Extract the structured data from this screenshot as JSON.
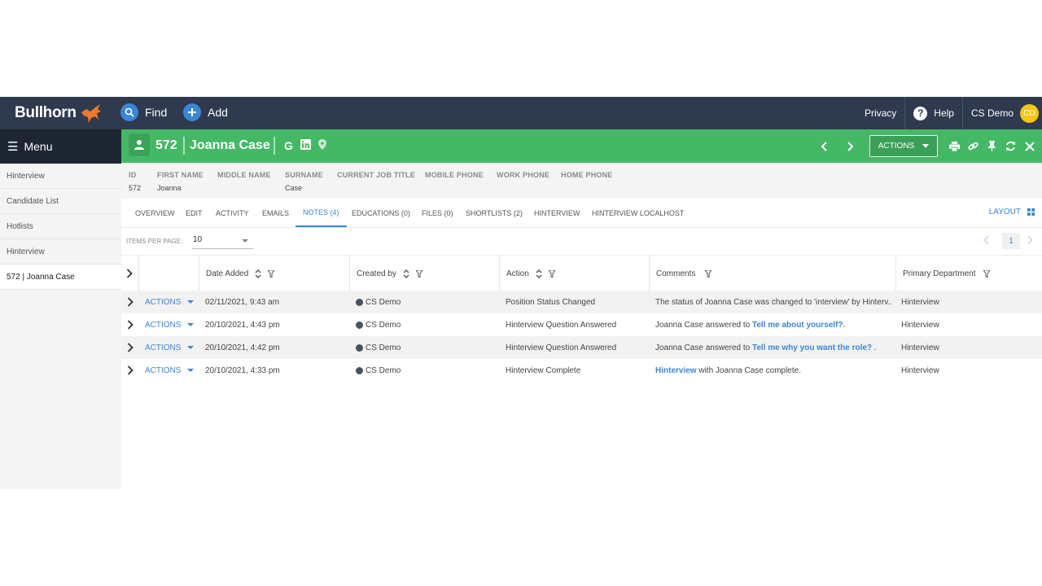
{
  "topbar": {
    "logo_text": "Bullhorn",
    "find_label": "Find",
    "add_label": "Add",
    "privacy_label": "Privacy",
    "help_label": "Help",
    "user_name": "CS Demo",
    "user_initials": "CD"
  },
  "sidebar": {
    "menu_label": "Menu",
    "items": [
      {
        "label": "Hinterview"
      },
      {
        "label": "Candidate List"
      },
      {
        "label": "Hotlists"
      },
      {
        "label": "Hinterview"
      },
      {
        "label": "572 | Joanna Case"
      }
    ]
  },
  "record": {
    "id": "572",
    "name": "Joanna Case",
    "actions_label": "ACTIONS",
    "header_color": "#45b866"
  },
  "fields": [
    {
      "label": "ID",
      "value": "572"
    },
    {
      "label": "FIRST NAME",
      "value": "Joanna"
    },
    {
      "label": "MIDDLE NAME",
      "value": ""
    },
    {
      "label": "SURNAME",
      "value": "Case"
    },
    {
      "label": "CURRENT JOB TITLE",
      "value": ""
    },
    {
      "label": "MOBILE PHONE",
      "value": ""
    },
    {
      "label": "WORK PHONE",
      "value": ""
    },
    {
      "label": "HOME PHONE",
      "value": ""
    }
  ],
  "tabs": [
    {
      "label": "OVERVIEW"
    },
    {
      "label": "EDIT"
    },
    {
      "label": "ACTIVITY"
    },
    {
      "label": "EMAILS"
    },
    {
      "label": "NOTES (4)"
    },
    {
      "label": "EDUCATIONS (0)"
    },
    {
      "label": "FILES (0)"
    },
    {
      "label": "SHORTLISTS (2)"
    },
    {
      "label": "HINTERVIEW"
    },
    {
      "label": "HINTERVIEW LOCALHOST"
    }
  ],
  "active_tab": "NOTES (4)",
  "layout_label": "LAYOUT",
  "pager": {
    "items_per_page_label": "ITEMS PER PAGE:",
    "items_per_page_value": "10",
    "current_page": "1"
  },
  "table": {
    "columns": [
      "Date Added",
      "Created by",
      "Action",
      "Comments",
      "Primary Department"
    ],
    "row_actions_label": "ACTIONS",
    "rows": [
      {
        "date": "02/11/2021, 9:43 am",
        "created_by": "CS Demo",
        "action": "Position Status Changed",
        "comment_pre": "The status of Joanna Case was changed to 'interview' by Hinterv...",
        "comment_link": "",
        "comment_post": "",
        "department": "Hinterview"
      },
      {
        "date": "20/10/2021, 4:43 pm",
        "created_by": "CS Demo",
        "action": "Hinterview Question Answered",
        "comment_pre": "Joanna Case answered to ",
        "comment_link": "Tell me about yourself?",
        "comment_post": ".",
        "department": "Hinterview"
      },
      {
        "date": "20/10/2021, 4:42 pm",
        "created_by": "CS Demo",
        "action": "Hinterview Question Answered",
        "comment_pre": "Joanna Case answered to ",
        "comment_link": "Tell me why you want the role?",
        "comment_post": " .",
        "department": "Hinterview"
      },
      {
        "date": "20/10/2021, 4:33 pm",
        "created_by": "CS Demo",
        "action": "Hinterview Complete",
        "comment_pre": "",
        "comment_link": "Hinterview",
        "comment_post": " with Joanna Case complete.",
        "department": "Hinterview"
      }
    ]
  }
}
